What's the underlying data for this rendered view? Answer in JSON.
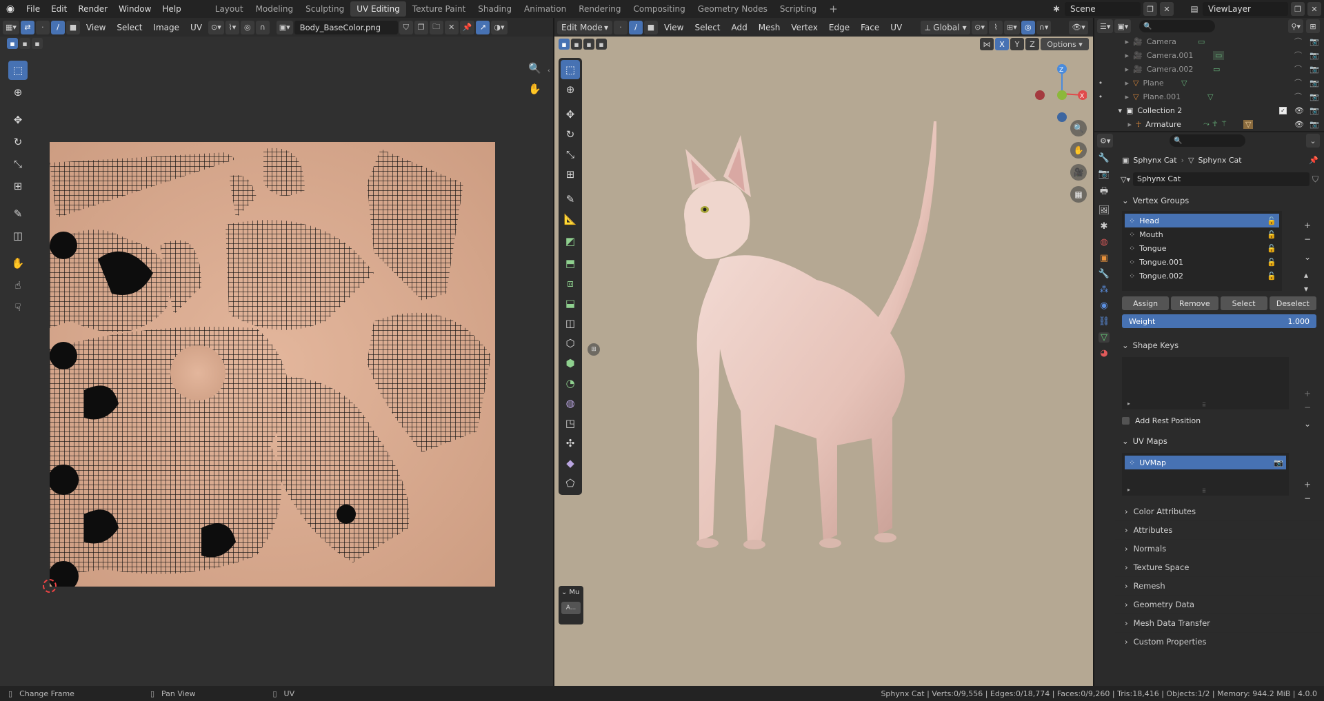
{
  "topbar": {
    "menus": [
      "File",
      "Edit",
      "Render",
      "Window",
      "Help"
    ],
    "workspaces": [
      "Layout",
      "Modeling",
      "Sculpting",
      "UV Editing",
      "Texture Paint",
      "Shading",
      "Animation",
      "Rendering",
      "Compositing",
      "Geometry Nodes",
      "Scripting"
    ],
    "active_workspace": "UV Editing",
    "add_tab": "+",
    "scene": "Scene",
    "view_layer": "ViewLayer"
  },
  "uv_editor": {
    "menus": [
      "View",
      "Select",
      "Image",
      "UV"
    ],
    "image_name": "Body_BaseColor.png",
    "skin_color": "#d8a88c"
  },
  "viewport": {
    "mode": "Edit Mode",
    "menus": [
      "View",
      "Select",
      "Add",
      "Mesh",
      "Vertex",
      "Edge",
      "Face",
      "UV"
    ],
    "orientation": "Global",
    "options_label": "Options",
    "axes": {
      "x": "X",
      "y": "Y",
      "z": "Z"
    },
    "background_color": "#b5a893",
    "operator_panel_label": "Mu",
    "operator_button_label": "A..."
  },
  "outliner": {
    "rows": [
      {
        "label": "Camera",
        "type": "camera"
      },
      {
        "label": "Camera.001",
        "type": "camera"
      },
      {
        "label": "Camera.002",
        "type": "camera"
      },
      {
        "label": "Plane",
        "type": "mesh"
      },
      {
        "label": "Plane.001",
        "type": "mesh"
      },
      {
        "label": "Collection 2",
        "type": "collection"
      },
      {
        "label": "Armature",
        "type": "armature"
      }
    ]
  },
  "properties": {
    "breadcrumb_object": "Sphynx Cat",
    "breadcrumb_data": "Sphynx Cat",
    "data_name": "Sphynx Cat",
    "vertex_groups_title": "Vertex Groups",
    "vertex_groups": [
      "Head",
      "Mouth",
      "Tongue",
      "Tongue.001",
      "Tongue.002"
    ],
    "assign": "Assign",
    "remove": "Remove",
    "select": "Select",
    "deselect": "Deselect",
    "weight_label": "Weight",
    "weight_value": "1.000",
    "shape_keys_title": "Shape Keys",
    "add_rest_position": "Add Rest Position",
    "uv_maps_title": "UV Maps",
    "uv_map": "UVMap",
    "collapsed_panels": [
      "Color Attributes",
      "Attributes",
      "Normals",
      "Texture Space",
      "Remesh",
      "Geometry Data",
      "Mesh Data Transfer",
      "Custom Properties"
    ]
  },
  "statusbar": {
    "left": [
      {
        "label": "Change Frame",
        "icon": "mouse-left-icon"
      },
      {
        "label": "Pan View",
        "icon": "mouse-middle-icon"
      },
      {
        "label": "UV",
        "icon": "mouse-right-icon"
      }
    ],
    "stats": "Sphynx Cat | Verts:0/9,556 | Edges:0/18,774 | Faces:0/9,260 | Tris:18,416 | Objects:1/2 | Memory: 944.2 MiB | 4.0.0"
  }
}
